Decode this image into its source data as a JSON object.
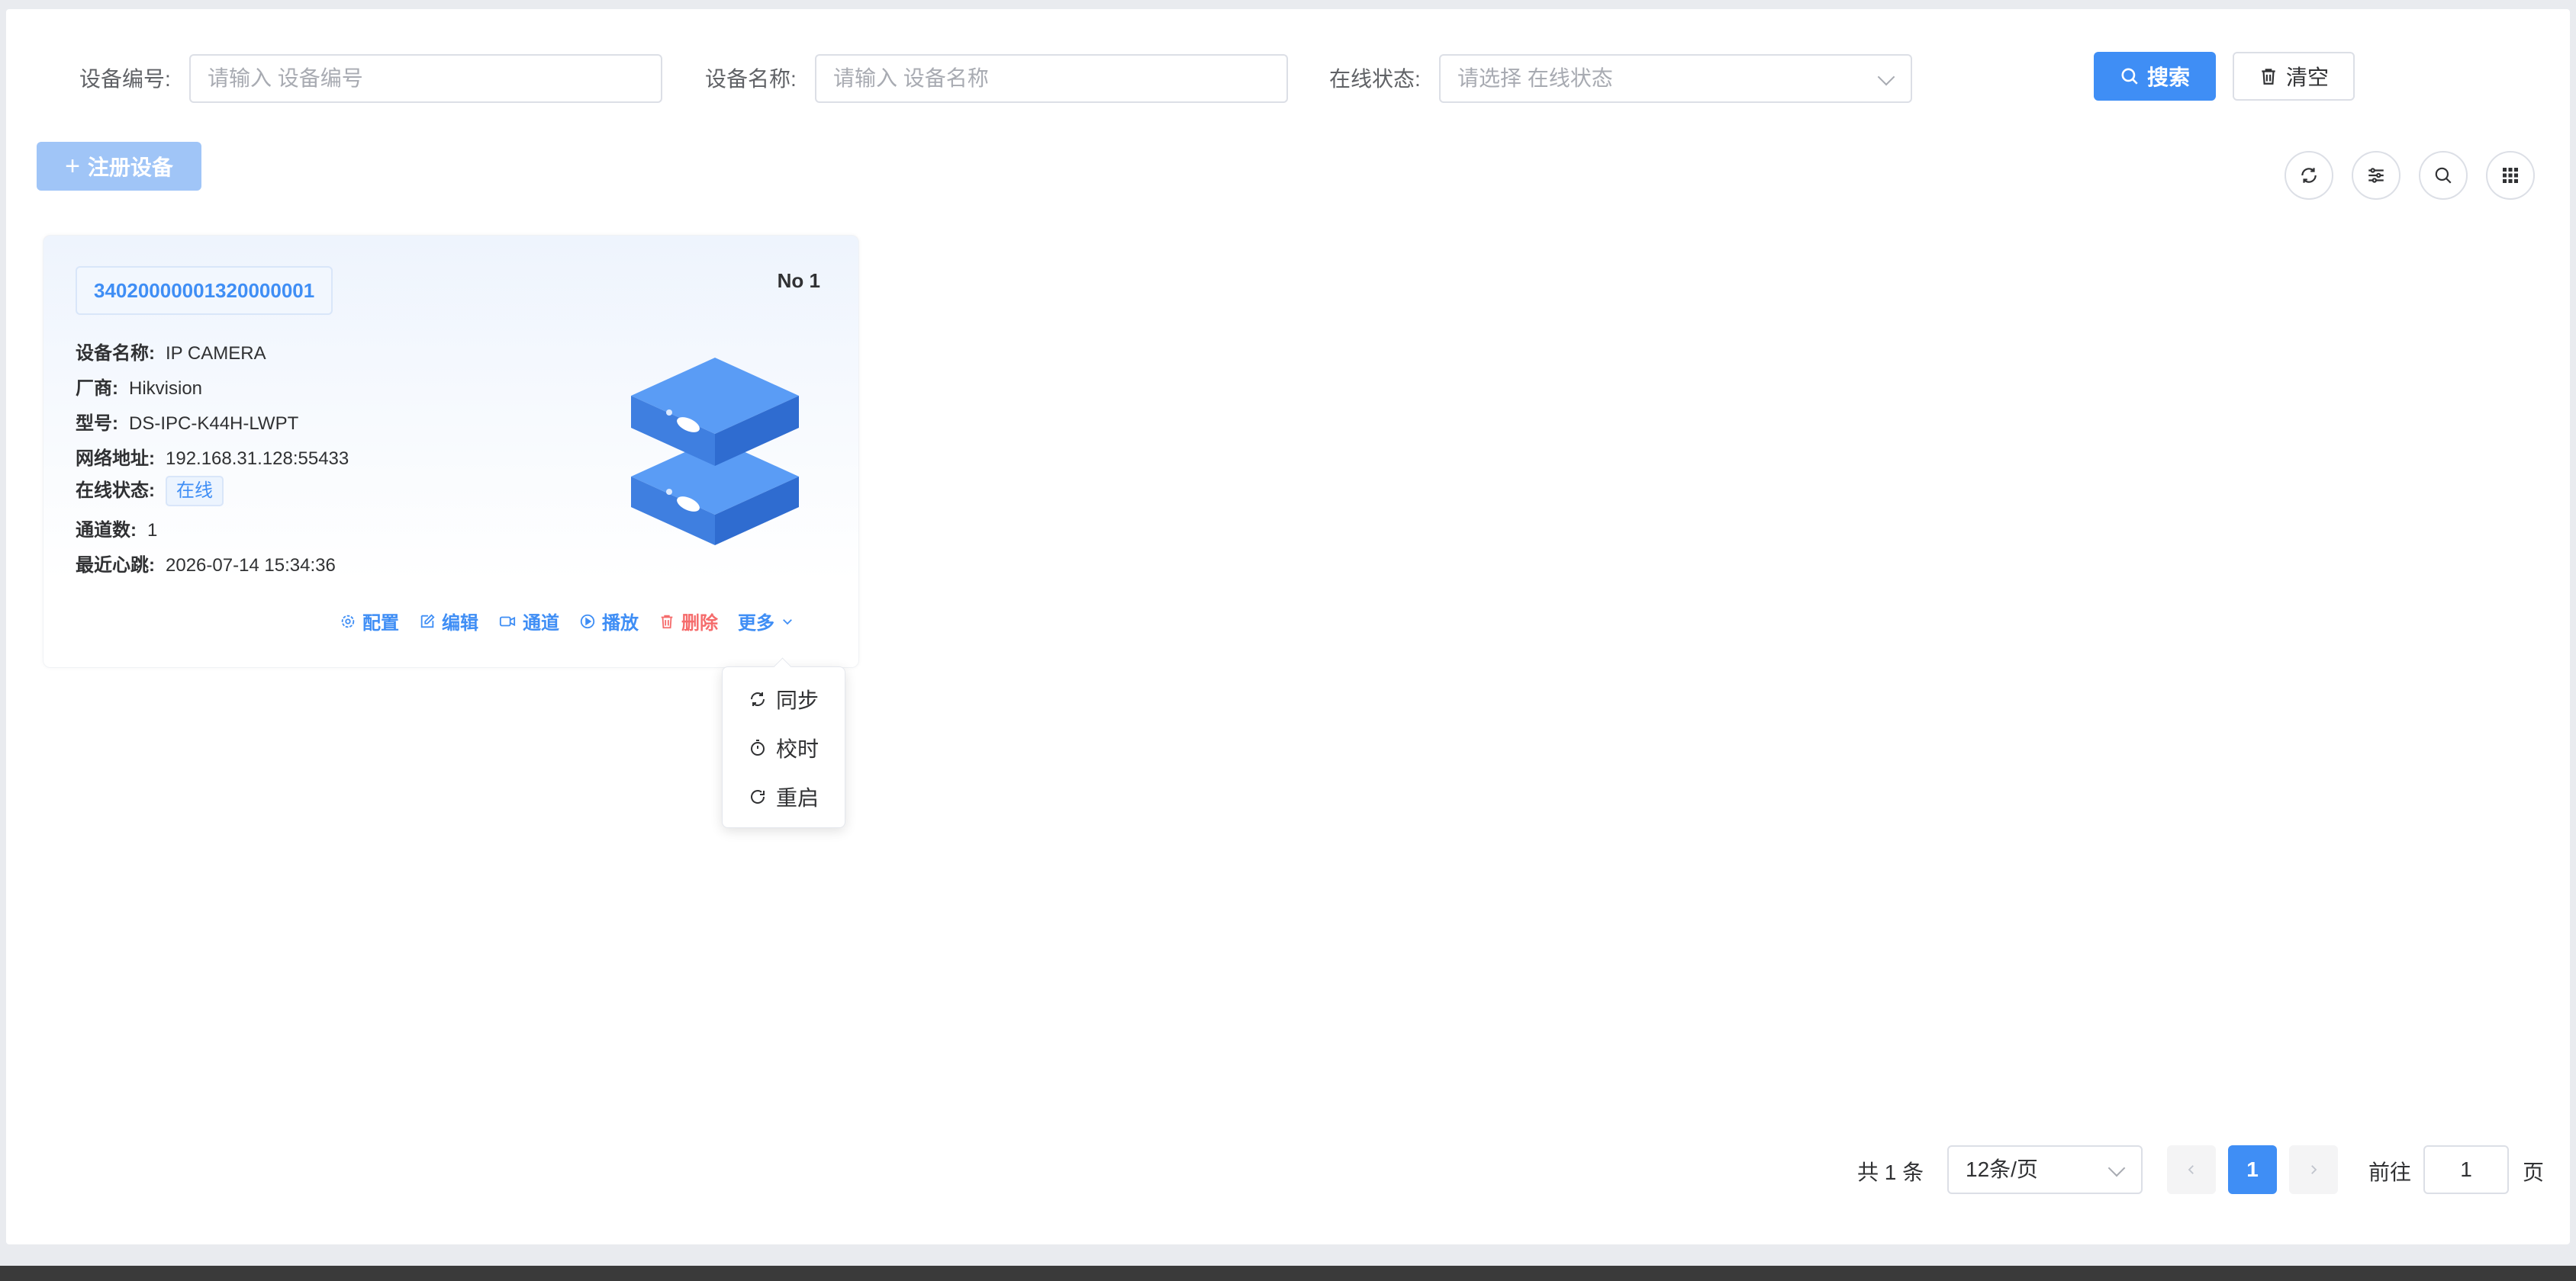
{
  "search": {
    "device_id_label": "设备编号:",
    "device_id_placeholder": "请输入 设备编号",
    "device_name_label": "设备名称:",
    "device_name_placeholder": "请输入 设备名称",
    "status_label": "在线状态:",
    "status_placeholder": "请选择 在线状态",
    "search_button": "搜索",
    "clear_button": "清空"
  },
  "toolbar": {
    "register_button": "注册设备",
    "icons": [
      "refresh-icon",
      "filter-settings-icon",
      "search-icon",
      "grid-icon"
    ]
  },
  "card": {
    "device_id": "34020000001320000001",
    "number_label": "No",
    "number": "1",
    "fields": [
      {
        "key": "设备名称:",
        "value": "IP CAMERA"
      },
      {
        "key": "厂商:",
        "value": "Hikvision"
      },
      {
        "key": "型号:",
        "value": "DS-IPC-K44H-LWPT"
      },
      {
        "key": "网络地址:",
        "value": "192.168.31.128:55433"
      },
      {
        "key": "在线状态:",
        "value": "在线"
      },
      {
        "key": "通道数:",
        "value": "1"
      },
      {
        "key": "最近心跳:",
        "value": "2026-07-14 15:34:36"
      }
    ],
    "actions": {
      "config": "配置",
      "edit": "编辑",
      "channel": "通道",
      "playback": "播放",
      "delete": "删除",
      "more": "更多"
    }
  },
  "more_menu": {
    "items": [
      "同步",
      "校时",
      "重启"
    ]
  },
  "pagination": {
    "total": "共 1 条",
    "page_size": "12条/页",
    "current_page": "1",
    "goto_label": "前往",
    "goto_value": "1",
    "page_suffix": "页"
  },
  "colors": {
    "primary": "#3f8ef5",
    "danger": "#f56c6c",
    "border": "#dcdfe6"
  }
}
